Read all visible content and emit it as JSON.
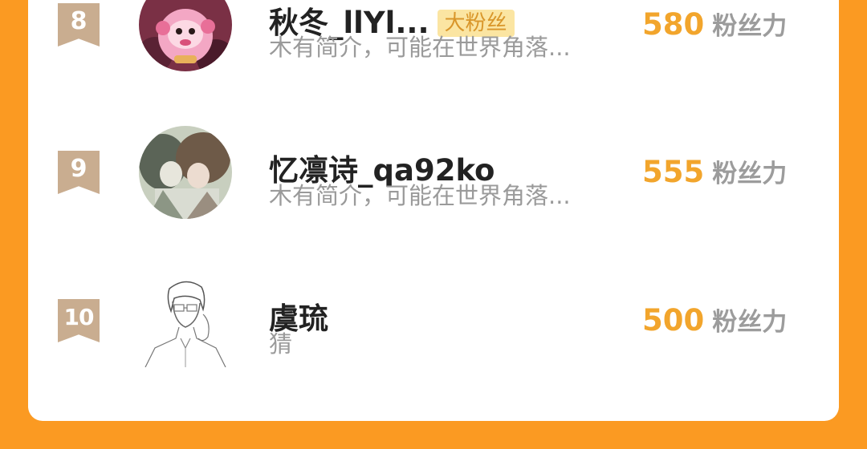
{
  "ranking": {
    "unit_label": "粉丝力",
    "items": [
      {
        "rank": "8",
        "name": "秋冬_llYl...",
        "badge": "大粉丝",
        "bio": "木有简介，可能在世界角落...",
        "score": "580",
        "avatar_icon": "pink-cartoon-character-avatar"
      },
      {
        "rank": "9",
        "name": "忆凛诗_qa92ko",
        "badge": "",
        "bio": "木有简介，可能在世界角落...",
        "score": "555",
        "avatar_icon": "illustrated-figures-avatar"
      },
      {
        "rank": "10",
        "name": "虞琉",
        "badge": "",
        "bio": "猜",
        "score": "500",
        "avatar_icon": "line-sketch-man-avatar"
      }
    ]
  },
  "colors": {
    "background": "#fb9a22",
    "card": "#ffffff",
    "rank_ribbon": "#c9ad90",
    "score": "#f2a52c",
    "badge_bg": "#fbe5a2",
    "badge_text": "#d9962a"
  }
}
